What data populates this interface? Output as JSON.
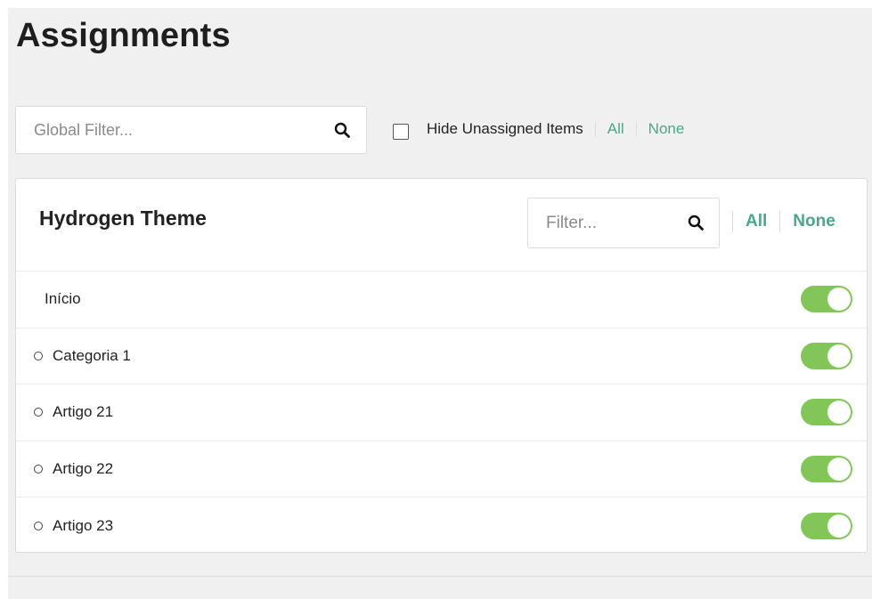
{
  "page": {
    "title": "Assignments"
  },
  "toolbar": {
    "global_filter_placeholder": "Global Filter...",
    "hide_unassigned_label": "Hide Unassigned Items",
    "hide_unassigned_checked": false,
    "all_label": "All",
    "none_label": "None"
  },
  "card": {
    "title": "Hydrogen Theme",
    "filter_placeholder": "Filter...",
    "all_label": "All",
    "none_label": "None",
    "items": [
      {
        "label": "Início",
        "level": 0,
        "enabled": true
      },
      {
        "label": "Categoria 1",
        "level": 1,
        "enabled": true
      },
      {
        "label": "Artigo 21",
        "level": 1,
        "enabled": true
      },
      {
        "label": "Artigo 22",
        "level": 1,
        "enabled": true
      },
      {
        "label": "Artigo 23",
        "level": 1,
        "enabled": true
      }
    ]
  },
  "colors": {
    "accent_link": "#4aa78a",
    "toggle_on": "#82c65a",
    "background": "#f0f0f0"
  },
  "icons": {
    "search": "search-icon",
    "bullet": "circle-bullet-icon"
  }
}
